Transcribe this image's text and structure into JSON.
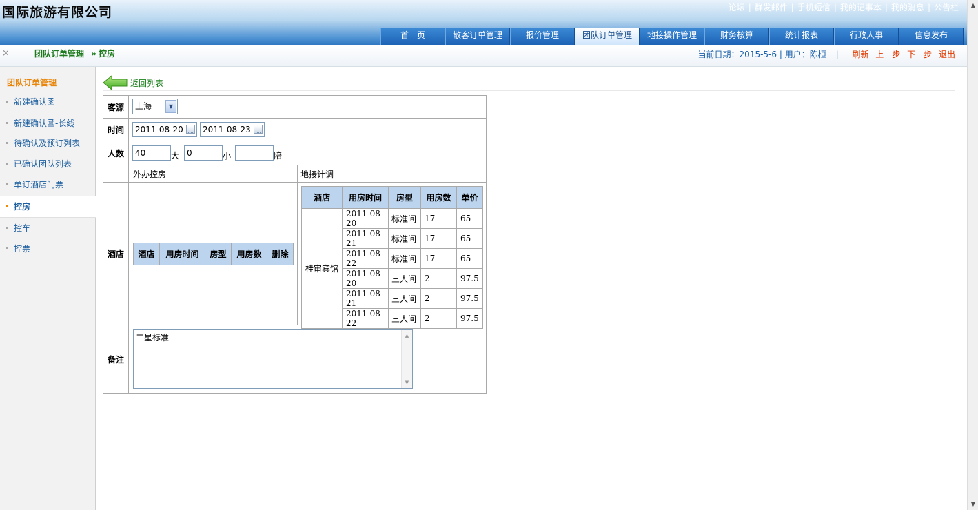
{
  "app": {
    "company": "国际旅游有限公司",
    "top_links": [
      "论坛",
      "群发邮件",
      "手机短信",
      "我的记事本",
      "我的消息",
      "公告栏"
    ],
    "nav_tabs": [
      {
        "label": "首　页",
        "active": false
      },
      {
        "label": "散客订单管理",
        "active": false
      },
      {
        "label": "报价管理",
        "active": false
      },
      {
        "label": "团队订单管理",
        "active": true
      },
      {
        "label": "地接操作管理",
        "active": false
      },
      {
        "label": "财务核算",
        "active": false
      },
      {
        "label": "统计报表",
        "active": false
      },
      {
        "label": "行政人事",
        "active": false
      },
      {
        "label": "信息发布",
        "active": false
      }
    ]
  },
  "subbar": {
    "close": "×",
    "breadcrumb_parent": "团队订单管理",
    "breadcrumb_sep": "»",
    "breadcrumb_current": "控房",
    "date_label": "当前日期：",
    "date": "2015-5-6",
    "user_label": "用户：",
    "user": "陈桓",
    "refresh": "刷新",
    "prev": "上一步",
    "next": "下一步",
    "logout": "退出"
  },
  "sidebar": {
    "title": "团队订单管理",
    "items": [
      {
        "label": "新建确认函",
        "active": false
      },
      {
        "label": "新建确认函-长线",
        "active": false
      },
      {
        "label": "待确认及预订列表",
        "active": false
      },
      {
        "label": "已确认团队列表",
        "active": false
      },
      {
        "label": "单订酒店门票",
        "active": false
      },
      {
        "label": "控房",
        "active": true
      },
      {
        "label": "控车",
        "active": false
      },
      {
        "label": "控票",
        "active": false
      }
    ]
  },
  "main": {
    "back_label": "返回列表",
    "source": {
      "label": "客源",
      "value": "上海"
    },
    "time": {
      "label": "时间",
      "start": "2011-08-20",
      "end": "2011-08-23"
    },
    "people": {
      "label": "人数",
      "adults": "40",
      "adults_unit": "大",
      "children": "0",
      "children_unit": "小",
      "escort": "",
      "escort_unit": "陪"
    },
    "sections": {
      "outsource": "外办控房",
      "local": "地接计调"
    },
    "hotel_label": "酒店",
    "outsource_table": {
      "headers": [
        "酒店",
        "用房时间",
        "房型",
        "用房数",
        "删除"
      ]
    },
    "local_table": {
      "headers": [
        "酒店",
        "用房时间",
        "房型",
        "用房数",
        "单价"
      ],
      "hotel": "桂审宾馆",
      "rows": [
        {
          "date": "2011-08-20",
          "type": "标准间",
          "count": "17",
          "price": "65"
        },
        {
          "date": "2011-08-21",
          "type": "标准间",
          "count": "17",
          "price": "65"
        },
        {
          "date": "2011-08-22",
          "type": "标准间",
          "count": "17",
          "price": "65"
        },
        {
          "date": "2011-08-20",
          "type": "三人间",
          "count": "2",
          "price": "97.5"
        },
        {
          "date": "2011-08-21",
          "type": "三人间",
          "count": "2",
          "price": "97.5"
        },
        {
          "date": "2011-08-22",
          "type": "三人间",
          "count": "2",
          "price": "97.5"
        }
      ]
    },
    "remark": {
      "label": "备注",
      "value": "二星标准"
    }
  },
  "colors": {
    "accent_orange": "#e8870d",
    "breadcrumb_green": "#1d7a1d",
    "header_blue": "#2f78c2",
    "table_header": "#bcd4ee"
  }
}
